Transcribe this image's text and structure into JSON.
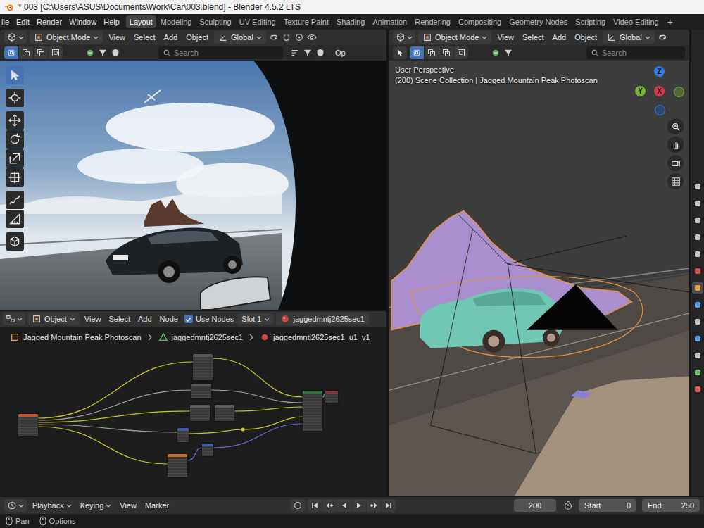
{
  "window": {
    "title": "* 003 [C:\\Users\\ASUS\\Documents\\Work\\Car\\003.blend] - Blender 4.5.2 LTS"
  },
  "menu": [
    "ile",
    "Edit",
    "Render",
    "Window",
    "Help"
  ],
  "workspaces": [
    {
      "label": "Layout",
      "selected": true
    },
    {
      "label": "Modeling",
      "selected": false
    },
    {
      "label": "Sculpting",
      "selected": false
    },
    {
      "label": "UV Editing",
      "selected": false
    },
    {
      "label": "Texture Paint",
      "selected": false
    },
    {
      "label": "Shading",
      "selected": false
    },
    {
      "label": "Animation",
      "selected": false
    },
    {
      "label": "Rendering",
      "selected": false
    },
    {
      "label": "Compositing",
      "selected": false
    },
    {
      "label": "Geometry Nodes",
      "selected": false
    },
    {
      "label": "Scripting",
      "selected": false
    },
    {
      "label": "Video Editing",
      "selected": false
    }
  ],
  "add_workspace": "+",
  "render_view": {
    "header": {
      "mode": "Object Mode",
      "menus": [
        "View",
        "Select",
        "Add",
        "Object"
      ],
      "orientation": "Global"
    },
    "select_modes": [
      {
        "selected": true
      },
      {
        "selected": false
      },
      {
        "selected": false
      },
      {
        "selected": false
      }
    ],
    "search": {
      "placeholder": "Search"
    },
    "options": "Op",
    "tools": [
      {
        "selected": true
      },
      {
        "selected": false
      },
      {
        "selected": false
      },
      {
        "selected": false
      },
      {
        "selected": false
      },
      {
        "selected": false
      },
      {
        "selected": false
      },
      {
        "selected": false
      },
      {
        "selected": false
      }
    ]
  },
  "viewport": {
    "header": {
      "mode": "Object Mode",
      "menus": [
        "View",
        "Select",
        "Add",
        "Object"
      ],
      "orientation": "Global"
    },
    "select_modes": [
      {
        "selected": true
      },
      {
        "selected": false
      },
      {
        "selected": false
      },
      {
        "selected": false
      }
    ],
    "search": {
      "placeholder": "Search"
    },
    "view_name": "User Perspective",
    "collection": "(200) Scene Collection | Jagged Mountain Peak Photoscan",
    "gizmo": [
      {
        "label": "Z",
        "color": "#2f7fe0"
      },
      {
        "label": "Y",
        "color": "#7bb33a"
      },
      {
        "label": "X",
        "color": "#d9384f"
      }
    ]
  },
  "node_editor": {
    "object_type": "Object",
    "menus": [
      "View",
      "Select",
      "Add",
      "Node"
    ],
    "use_nodes": {
      "label": "Use Nodes",
      "checked": true
    },
    "slot": "Slot 1",
    "material": "jaggedmntj2625sec1",
    "breadcrumb": [
      "Jagged Mountain Peak Photoscan",
      "jaggedmntj2625sec1",
      "jaggedmntj2625sec1_u1_v1"
    ]
  },
  "properties_tabs": [
    {
      "selected": false
    },
    {
      "selected": false
    },
    {
      "selected": false
    },
    {
      "selected": false
    },
    {
      "selected": false
    },
    {
      "selected": false
    },
    {
      "selected": true
    },
    {
      "selected": false
    },
    {
      "selected": false
    },
    {
      "selected": false
    },
    {
      "selected": false
    },
    {
      "selected": false
    },
    {
      "selected": false
    }
  ],
  "timeline": {
    "menus": [
      {
        "label": "Playback",
        "kind": "dropdown"
      },
      {
        "label": "Keying",
        "kind": "dropdown"
      },
      {
        "label": "View",
        "kind": "menu"
      },
      {
        "label": "Marker",
        "kind": "menu"
      }
    ],
    "current_frame": "200",
    "start": {
      "label": "Start",
      "value": "0"
    },
    "end": {
      "label": "End",
      "value": "250"
    }
  },
  "status_bar": [
    {
      "label": "Pan"
    },
    {
      "label": "Options"
    }
  ]
}
